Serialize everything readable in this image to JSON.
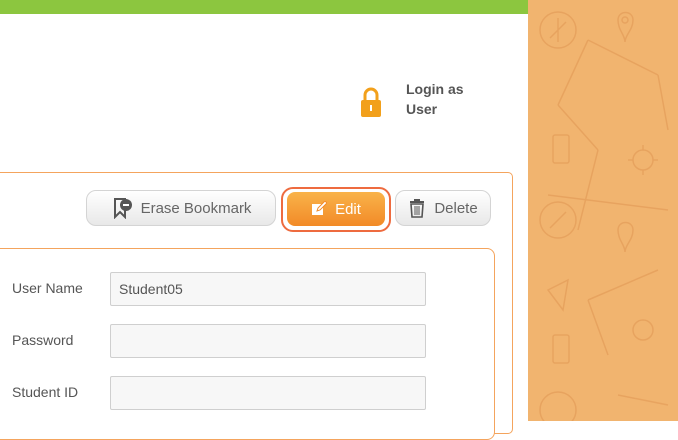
{
  "login": {
    "line1": "Login as",
    "line2": "User"
  },
  "toolbar": {
    "erase_label": "Erase Bookmark",
    "edit_label": "Edit",
    "delete_label": "Delete"
  },
  "form": {
    "fields": [
      {
        "label": "User Name",
        "value": "Student05"
      },
      {
        "label": "Password",
        "value": ""
      },
      {
        "label": "Student ID",
        "value": ""
      }
    ]
  },
  "colors": {
    "topbar": "#8cc63f",
    "side_panel": "#f1b46f",
    "accent": "#f28a27",
    "border": "#f4a45d"
  }
}
